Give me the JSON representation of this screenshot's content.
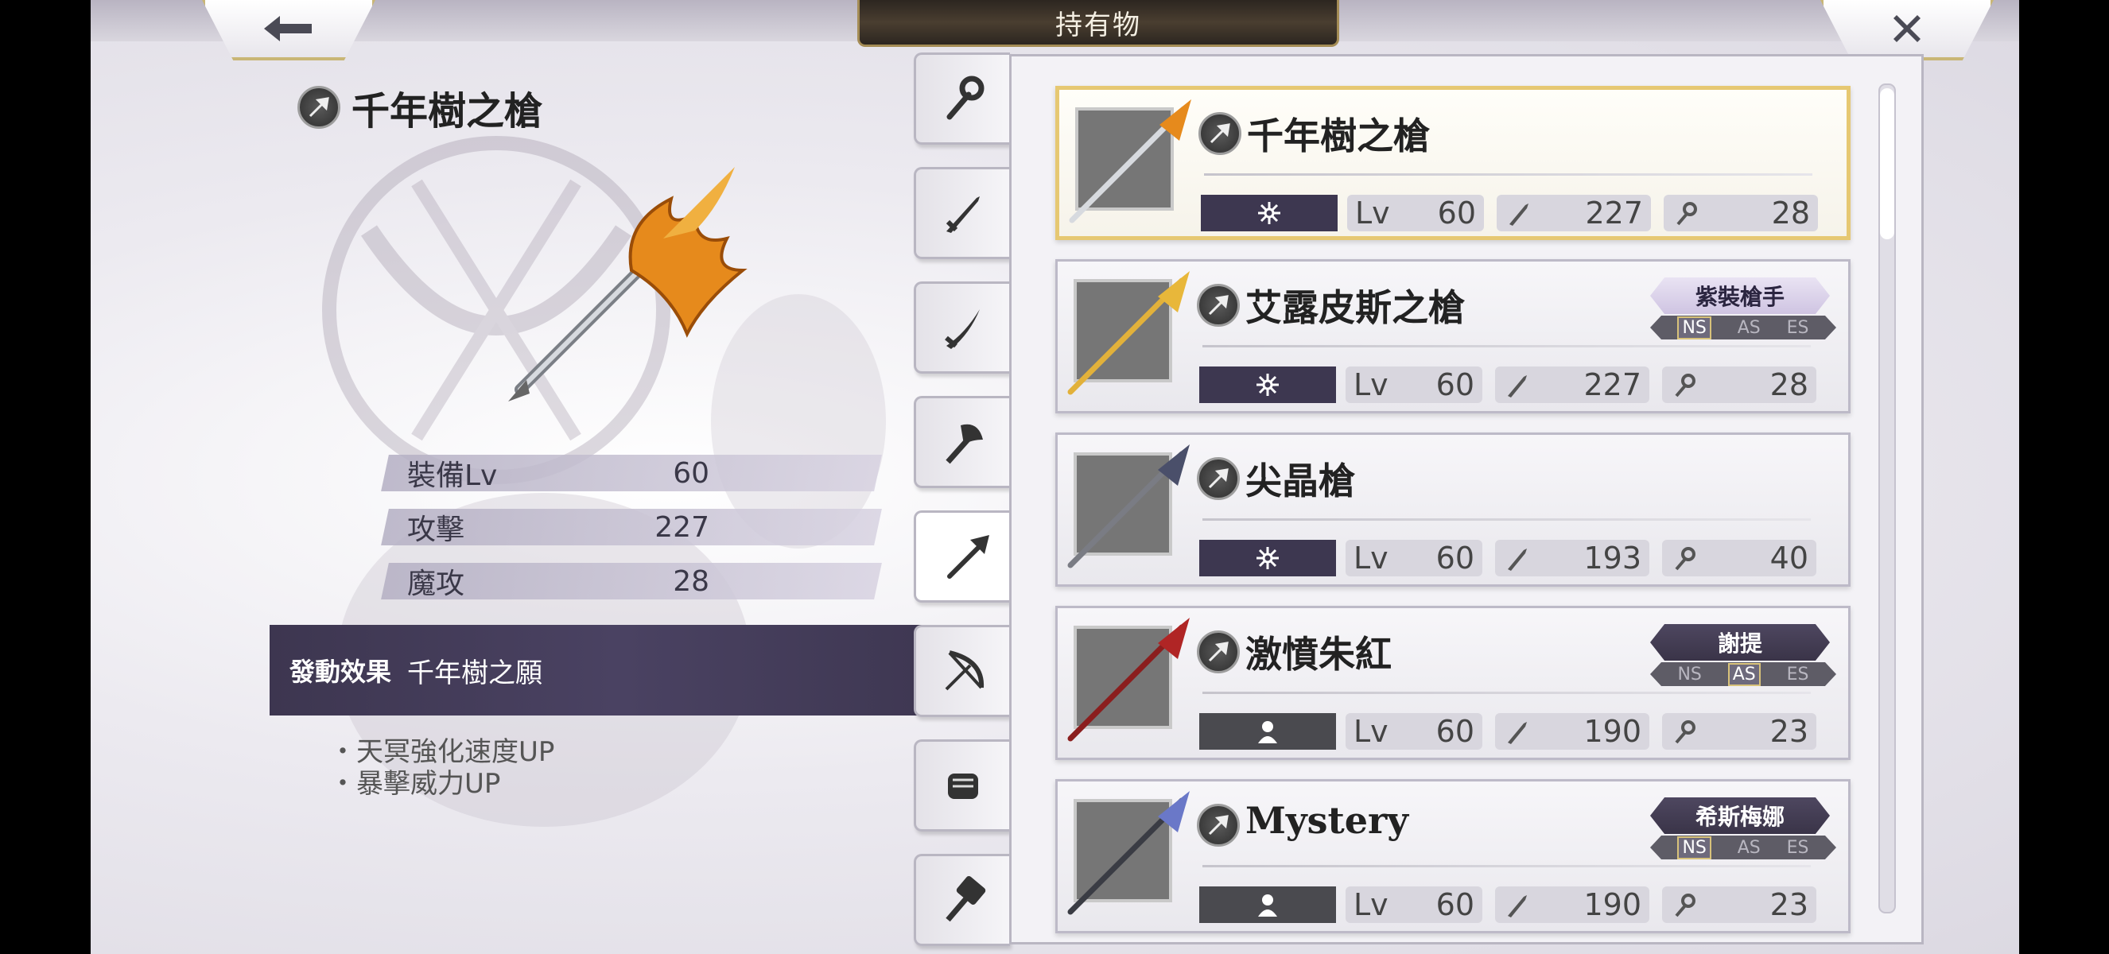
{
  "header": {
    "title": "持有物",
    "back_icon": "back-arrow-icon",
    "close_icon": "close-icon"
  },
  "detail": {
    "name": "千年樹之槍",
    "type_icon": "spear-type-icon",
    "stats": [
      {
        "label": "裝備Lv",
        "value": "60"
      },
      {
        "label": "攻擊",
        "value": "227"
      },
      {
        "label": "魔攻",
        "value": "28"
      }
    ],
    "effect_key": "發動效果",
    "effect_name": "千年樹之願",
    "effects": [
      "・天冥強化速度UP",
      "・暴擊威力UP"
    ]
  },
  "tabs": [
    {
      "name": "staff",
      "icon": "staff-icon"
    },
    {
      "name": "sword",
      "icon": "sword-icon"
    },
    {
      "name": "katana",
      "icon": "katana-icon"
    },
    {
      "name": "axe",
      "icon": "axe-icon"
    },
    {
      "name": "spear",
      "icon": "spear-icon",
      "active": true
    },
    {
      "name": "bow",
      "icon": "bow-icon"
    },
    {
      "name": "fist",
      "icon": "fist-icon"
    },
    {
      "name": "hammer",
      "icon": "hammer-icon"
    }
  ],
  "items": [
    {
      "name": "千年樹之槍",
      "lv_label": "Lv",
      "lv": "60",
      "atk": "227",
      "matk": "28",
      "element": "light",
      "selected": true,
      "badge": "",
      "modes": []
    },
    {
      "name": "艾露皮斯之槍",
      "lv_label": "Lv",
      "lv": "60",
      "atk": "227",
      "matk": "28",
      "element": "light",
      "badge": "紫裝槍手",
      "badge_style": "light",
      "modes": [
        "NS",
        "AS",
        "ES"
      ],
      "mode_on": "NS"
    },
    {
      "name": "尖晶槍",
      "lv_label": "Lv",
      "lv": "60",
      "atk": "193",
      "matk": "40",
      "element": "light",
      "badge": "",
      "modes": []
    },
    {
      "name": "激憤朱紅",
      "lv_label": "Lv",
      "lv": "60",
      "atk": "190",
      "matk": "23",
      "element": "person",
      "badge": "謝提",
      "badge_style": "dark",
      "modes": [
        "NS",
        "AS",
        "ES"
      ],
      "mode_on": "AS"
    },
    {
      "name": "Mystery",
      "lv_label": "Lv",
      "lv": "60",
      "atk": "190",
      "matk": "23",
      "element": "person",
      "badge": "希斯梅娜",
      "badge_style": "dark",
      "modes": [
        "NS",
        "AS",
        "ES"
      ],
      "mode_on": "NS"
    }
  ],
  "colors": {
    "selected_border": "#e6c872",
    "badge_dark": "#3a3448",
    "panel_bg": "#f3f2f6"
  }
}
